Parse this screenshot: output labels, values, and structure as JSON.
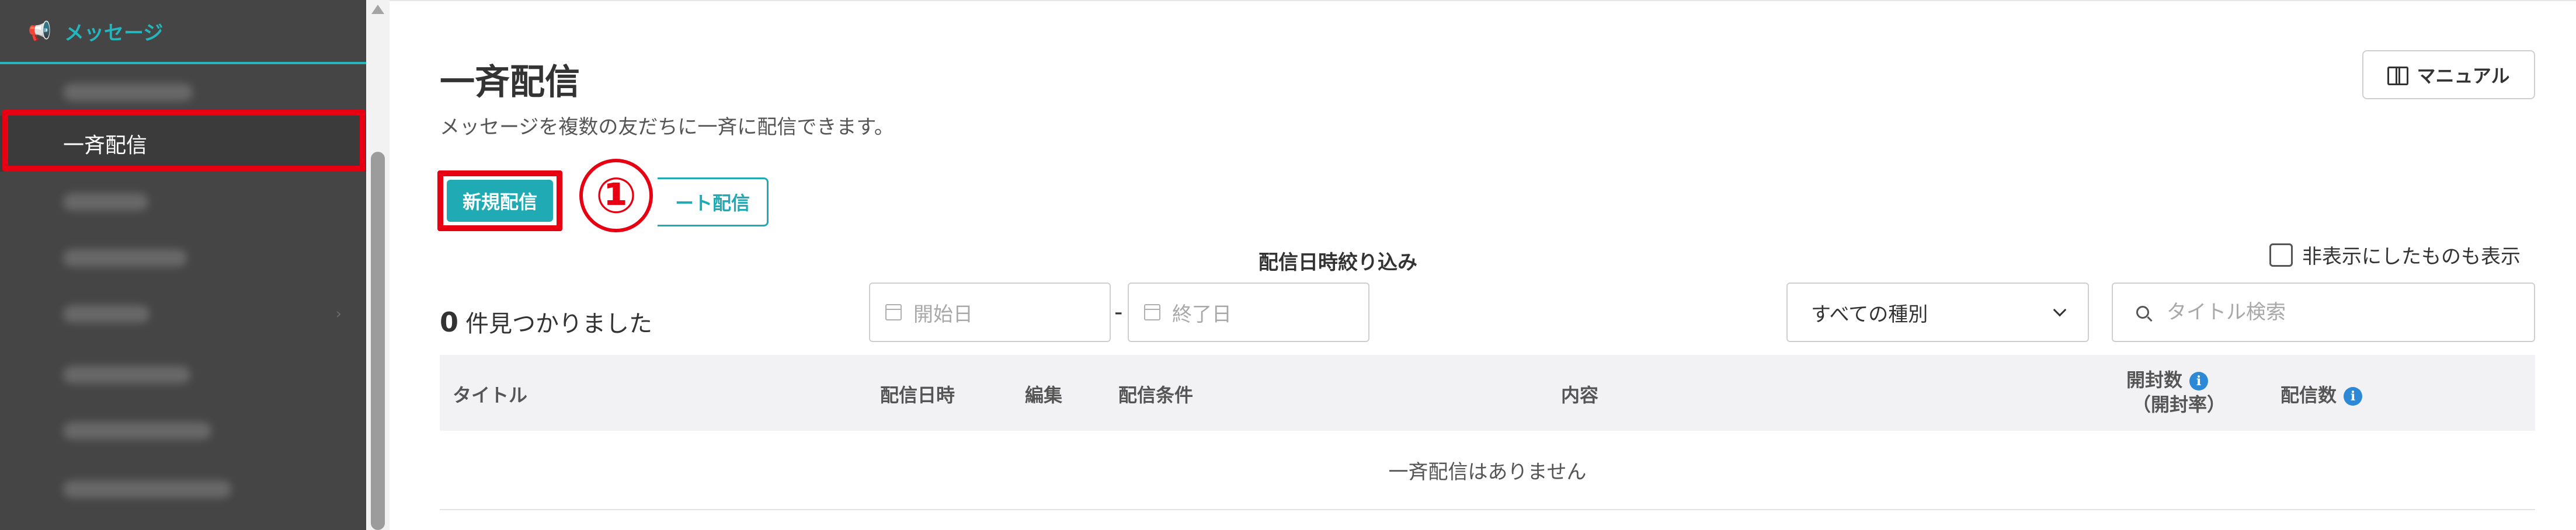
{
  "sidebar": {
    "section_label": "メッセージ",
    "items": [
      {
        "label": "",
        "active": false
      },
      {
        "label": "一斉配信",
        "active": true
      },
      {
        "label": "",
        "active": false
      },
      {
        "label": "",
        "active": false
      },
      {
        "label": "",
        "active": false
      },
      {
        "label": "",
        "active": false
      },
      {
        "label": "",
        "active": false
      },
      {
        "label": "",
        "active": false
      }
    ]
  },
  "header": {
    "title": "一斉配信",
    "description": "メッセージを複数の友だちに一斉に配信できます。",
    "manual_label": "マニュアル"
  },
  "actions": {
    "new_label": "新規配信",
    "step_marker": "①",
    "second_label": "ート配信"
  },
  "filters": {
    "date_label": "配信日時絞り込み",
    "start_placeholder": "開始日",
    "end_placeholder": "終了日",
    "separator": "-",
    "type_selected": "すべての種別",
    "search_placeholder": "タイトル検索",
    "hide_label": "非表示にしたものも表示"
  },
  "results": {
    "count": "0",
    "text": "件見つかりました"
  },
  "table": {
    "columns": {
      "title": "タイトル",
      "date": "配信日時",
      "edit": "編集",
      "condition": "配信条件",
      "content": "内容",
      "opens": "開封数",
      "open_rate": "（開封率）",
      "delivered": "配信数"
    },
    "empty_text": "一斉配信はありません"
  },
  "colors": {
    "accent": "#20aab3",
    "sidebar_bg": "#454545",
    "highlight": "#e60012",
    "info": "#2d89d6"
  },
  "icons": {
    "section": "megaphone-icon",
    "manual": "book-icon",
    "date": "calendar-icon",
    "search": "search-icon",
    "info": "info-icon"
  }
}
